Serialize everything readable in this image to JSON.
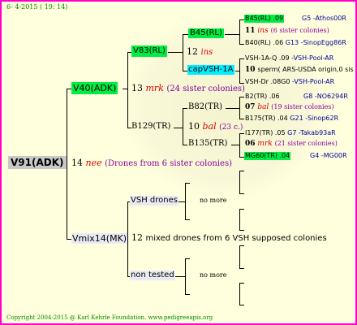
{
  "header": {
    "date": "6- 4-2015 ( 19: 14)"
  },
  "root": {
    "name": "V91(ADK)"
  },
  "root_info": {
    "num": "14",
    "abbr": "nee",
    "note": "(Drones from 6 sister colonies)"
  },
  "v40": {
    "name": "V40(ADK)",
    "num": "13",
    "abbr": "mrk",
    "note": "(24 sister colonies)"
  },
  "v83": {
    "name": "V83(RL)",
    "num": "12",
    "abbr": "ins"
  },
  "b45": {
    "name": "B45(RL)",
    "extra": ".09",
    "other": "G5 -Athos00R"
  },
  "ins_note": {
    "num": "11",
    "abbr": "ins",
    "note": "(6 sister colonies)"
  },
  "b40": {
    "name": "B40(RL)",
    "extra": ".06",
    "other": "G13 -SinopEgg86R"
  },
  "capvsh": {
    "name": "capVSH-1A"
  },
  "vsh1aq": {
    "name": "VSH-1A-Q",
    "extra": ".09",
    "other": "-VSH-Pool-AR"
  },
  "sperm": {
    "num": "10",
    "text": "sperm( ARS-USDA origin,0 sis"
  },
  "vshdr": {
    "name": "VSH-Dr",
    "extra": ".08G0",
    "other": "-VSH-Pool-AR"
  },
  "b129": {
    "name": "B129(TR)",
    "num": "10",
    "abbr": "bal",
    "note": "(23 c.)"
  },
  "b82": {
    "name": "B82(TR)"
  },
  "b2": {
    "name": "B2(TR)",
    "extra": ".06",
    "other": "G8 -NO6294R"
  },
  "bal_note": {
    "num": "07",
    "abbr": "bal",
    "note": "(19 sister colonies)"
  },
  "b175": {
    "name": "B175(TR)",
    "extra": ".04",
    "other": "G21 -Sinop62R"
  },
  "b135": {
    "name": "B135(TR)"
  },
  "i177": {
    "name": "I177(TR)",
    "extra": ".05",
    "other": "G7 -Takab93aR"
  },
  "mrk_note": {
    "num": "06",
    "abbr": "mrk",
    "note": "(21 sister colonies)"
  },
  "mg60": {
    "name": "MG60(TR)",
    "extra": ".04",
    "other": "G4 -MG00R"
  },
  "vshdrones": {
    "name": "VSH drones",
    "value": "no more"
  },
  "vmix": {
    "name": "Vmix14(MK)",
    "num": "12",
    "note": "mixed drones from 6 VSH supposed colonies"
  },
  "nontested": {
    "name": "non tested",
    "value": "no more"
  },
  "footer": {
    "copyright": "Copyright 2004-2015 @ Karl Kehrle Foundation.",
    "url": "www.pedigreeapis.org"
  }
}
